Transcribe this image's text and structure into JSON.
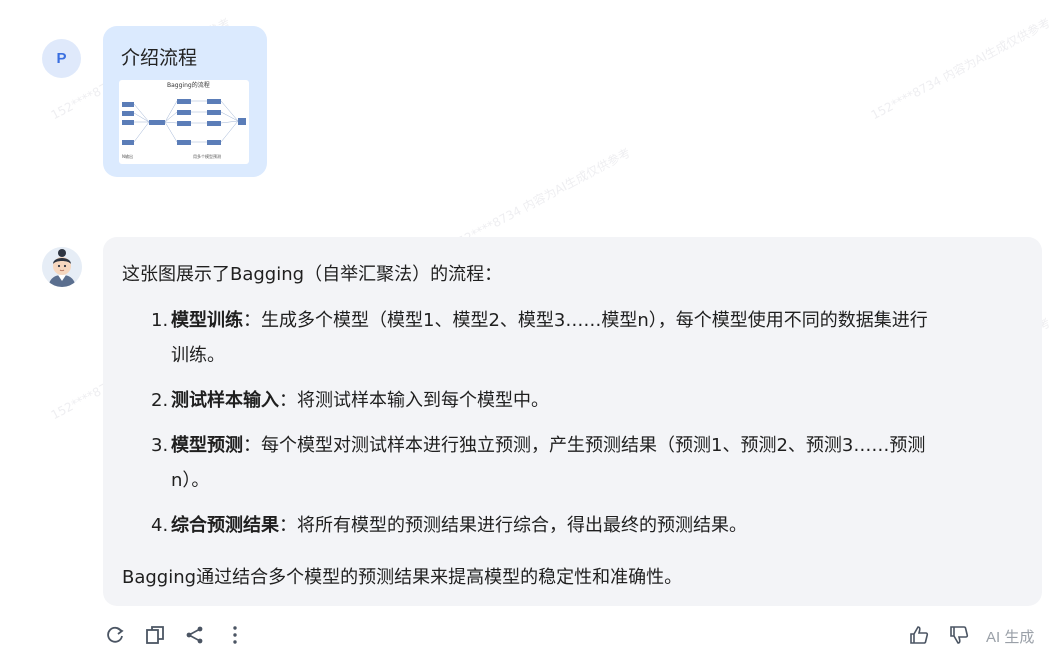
{
  "user": {
    "avatar_letter": "P",
    "message": "介绍流程",
    "thumbnail": {
      "title": "Bagging的流程",
      "label_left": "N输出",
      "label_right": "用多个模型预测"
    }
  },
  "assistant": {
    "intro": "这张图展示了Bagging（自举汇聚法）的流程：",
    "steps": [
      {
        "num": "1.",
        "bold": "模型训练",
        "text": "：生成多个模型（模型1、模型2、模型3……模型n），每个模型使用不同的数据集进行",
        "cont": "训练。"
      },
      {
        "num": "2.",
        "bold": "测试样本输入",
        "text": "：将测试样本输入到每个模型中。",
        "cont": ""
      },
      {
        "num": "3.",
        "bold": "模型预测",
        "text": "：每个模型对测试样本进行独立预测，产生预测结果（预测1、预测2、预测3……预测",
        "cont": "n）。"
      },
      {
        "num": "4.",
        "bold": "综合预测结果",
        "text": "：将所有模型的预测结果进行综合，得出最终的预测结果。",
        "cont": ""
      }
    ],
    "summary": "Bagging通过结合多个模型的预测结果来提高模型的稳定性和准确性。"
  },
  "toolbar": {
    "icons": [
      "refresh-icon",
      "copy-icon",
      "share-icon",
      "more-icon",
      "thumbs-up-icon",
      "thumbs-down-icon"
    ],
    "ai_label": "AI 生成"
  },
  "watermark_text": "152****8734 内容为AI生成仅供参考",
  "colors": {
    "user_bubble": "#dbeafe",
    "bot_bubble": "#f3f4f7",
    "avatar_bg": "#dfe9fb",
    "avatar_letter": "#3a6fe0",
    "thumb_box": "#5b7db8"
  }
}
